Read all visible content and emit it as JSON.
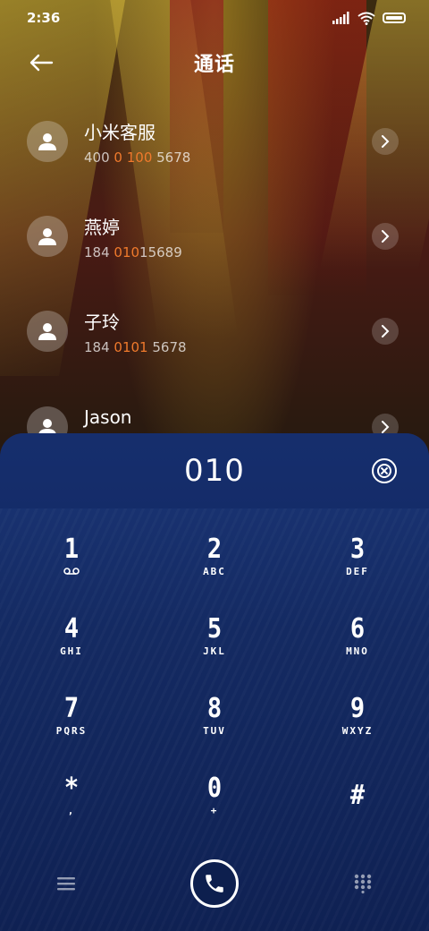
{
  "status_bar": {
    "time": "2:36"
  },
  "header": {
    "title": "通话"
  },
  "contacts": [
    {
      "name": "小米客服",
      "number_pre": "400 ",
      "number_hl": "0",
      "number_mid": " ",
      "number_hl2": "100",
      "number_post": " 5678"
    },
    {
      "name": "燕婷",
      "number_pre": "184 ",
      "number_hl": "010",
      "number_mid": "",
      "number_hl2": "",
      "number_post": "15689"
    },
    {
      "name": "子玲",
      "number_pre": "184 ",
      "number_hl": "0101",
      "number_mid": "",
      "number_hl2": "",
      "number_post": " 5678"
    },
    {
      "name": "Jason",
      "number_pre": "",
      "number_hl": "",
      "number_mid": "",
      "number_hl2": "",
      "number_post": ""
    }
  ],
  "dialpad": {
    "input_value": "010",
    "keys": [
      {
        "digit": "1",
        "letters": ""
      },
      {
        "digit": "2",
        "letters": "ABC"
      },
      {
        "digit": "3",
        "letters": "DEF"
      },
      {
        "digit": "4",
        "letters": "GHI"
      },
      {
        "digit": "5",
        "letters": "JKL"
      },
      {
        "digit": "6",
        "letters": "MNO"
      },
      {
        "digit": "7",
        "letters": "PQRS"
      },
      {
        "digit": "8",
        "letters": "TUV"
      },
      {
        "digit": "9",
        "letters": "WXYZ"
      },
      {
        "digit": "*",
        "letters": ","
      },
      {
        "digit": "0",
        "letters": "+"
      },
      {
        "digit": "#",
        "letters": ""
      }
    ]
  },
  "icons": {
    "back": "arrow-left-icon",
    "avatar": "person-icon",
    "chevron": "chevron-right-icon",
    "clear": "clear-icon",
    "voicemail": "voicemail-icon",
    "menu": "menu-icon",
    "call": "phone-icon",
    "keypad": "keypad-icon"
  },
  "colors": {
    "highlight": "#f07a2c",
    "dialpad_bg": "#142a62"
  }
}
